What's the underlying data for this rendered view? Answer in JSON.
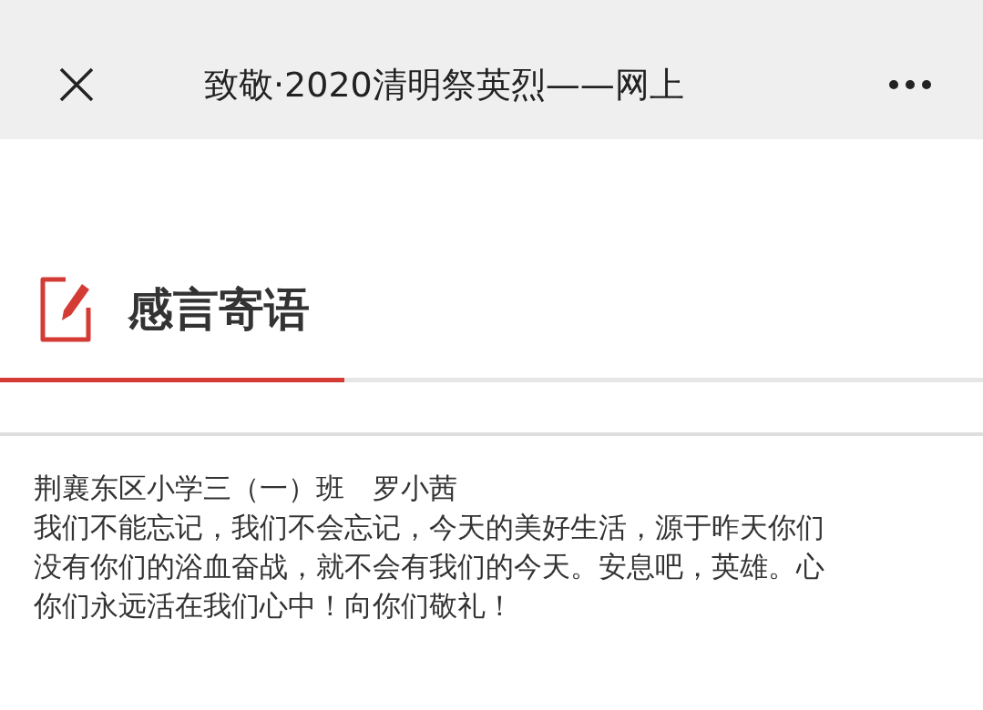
{
  "top_bar": {
    "title": "致敬·2020清明祭英烈——网上"
  },
  "section": {
    "title": "感言寄语",
    "selected": true
  },
  "message": {
    "author": "荆襄东区小学三（一）班　罗小茜",
    "lines": [
      "我们不能忘记，我们不会忘记，今天的美好生活，源于昨天你们",
      "没有你们的浴血奋战，就不会有我们的今天。安息吧，英雄。心",
      "你们永远活在我们心中！向你们敬礼！"
    ]
  }
}
